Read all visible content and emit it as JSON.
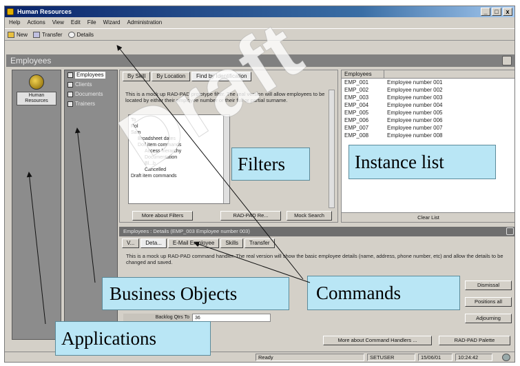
{
  "window": {
    "title": "Human Resources",
    "controls": [
      "_",
      "□",
      "x"
    ]
  },
  "menu": [
    "Help",
    "Actions",
    "View",
    "Edit",
    "File",
    "Wizard",
    "Administration"
  ],
  "toolbar": [
    {
      "label": "New",
      "icon": "folder-icon"
    },
    {
      "label": "Transfer",
      "icon": "transfer-icon"
    },
    {
      "label": "Details",
      "icon": "magnifier-icon"
    }
  ],
  "section_title": "Employees",
  "applications": [
    {
      "label": "Human Resources",
      "icon": "person-icon"
    }
  ],
  "business_objects": [
    {
      "label": "Employees",
      "selected": true
    },
    {
      "label": "Clients",
      "selected": false
    },
    {
      "label": "Documents",
      "selected": false
    },
    {
      "label": "Trainers",
      "selected": false
    }
  ],
  "filter": {
    "tabs": [
      "By Skill",
      "By Location",
      "Find by Identification"
    ],
    "active_tab": 2,
    "description": "This is a mock up RAD-PAD prototype filter. The real version will allow employees to be located by either their employee number or their full or partial surname.",
    "tree": [
      "To",
      "Rol",
      "Sam",
      "Broadsheet dates",
      "Doll item commands",
      "Access hierarchy",
      "Documentation",
      "Bl...b",
      "Cancelled",
      "Draft item commands"
    ],
    "buttons": [
      "More about Filters",
      "RAD-PAD Re...",
      "Mock Search"
    ]
  },
  "instances": {
    "column": "Employees",
    "rows": [
      {
        "id": "EMP_001",
        "name": "Employee number 001"
      },
      {
        "id": "EMP_002",
        "name": "Employee number 002"
      },
      {
        "id": "EMP_003",
        "name": "Employee number 003"
      },
      {
        "id": "EMP_004",
        "name": "Employee number 004"
      },
      {
        "id": "EMP_005",
        "name": "Employee number 005"
      },
      {
        "id": "EMP_006",
        "name": "Employee number 006"
      },
      {
        "id": "EMP_007",
        "name": "Employee number 007"
      },
      {
        "id": "EMP_008",
        "name": "Employee number 008"
      }
    ],
    "footer_button": "Clear List"
  },
  "details": {
    "title": "Employees : Details (EMP_003 Employee number 003)",
    "tabs": [
      "V...",
      "Deta...",
      "E-Mail Employee",
      "Skills",
      "Transfer"
    ],
    "description": "This is a mock up RAD-PAD command handler. The real version will show the basic employee details (name, address, phone number, etc) and allow the details to be changed and saved.",
    "field_label": "Backlog Qtrs To",
    "field_value": "36",
    "side_buttons": [
      "Dismissal",
      "Positions all",
      "Adjourning"
    ],
    "bottom_buttons": [
      "More about Command Handlers ...",
      "RAD-PAD Palette"
    ]
  },
  "status": [
    "Ready",
    "SETUSER",
    "15/06/01",
    "10:24:42"
  ],
  "callouts": {
    "filters": "Filters",
    "instance_list": "Instance list",
    "business_objects": "Business Objects",
    "commands": "Commands",
    "applications": "Applications"
  },
  "watermark": "Draft"
}
